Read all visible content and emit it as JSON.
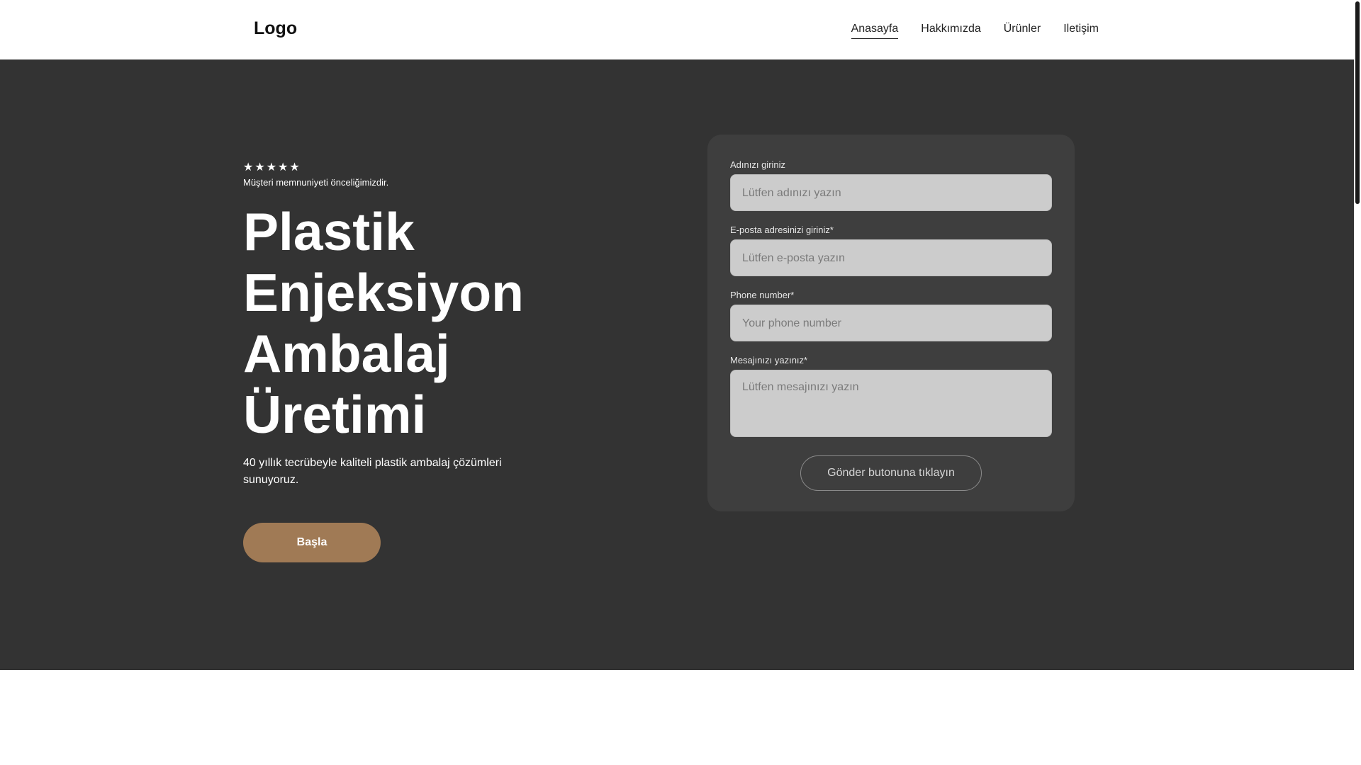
{
  "header": {
    "logo": "Logo",
    "nav": [
      {
        "label": "Anasayfa",
        "active": true
      },
      {
        "label": "Hakkımızda",
        "active": false
      },
      {
        "label": "Ürünler",
        "active": false
      },
      {
        "label": "Iletişim",
        "active": false
      }
    ]
  },
  "hero": {
    "stars": "★★★★★",
    "rating": 5,
    "tagline": "Müşteri memnuniyeti önceliğimizdir.",
    "title_lines": [
      "Plastik",
      "Enjeksiyon",
      "Ambalaj",
      "Üretimi"
    ],
    "subtitle": "40 yıllık tecrübeyle kaliteli plastik ambalaj çözümleri sunuyoruz.",
    "cta_label": "Başla"
  },
  "form": {
    "name": {
      "label": "Adınızı giriniz",
      "placeholder": "Lütfen adınızı yazın",
      "value": ""
    },
    "email": {
      "label": "E-posta adresinizi giriniz*",
      "placeholder": "Lütfen e-posta yazın",
      "value": ""
    },
    "phone": {
      "label": "Phone number*",
      "placeholder": "Your phone number",
      "value": ""
    },
    "message": {
      "label": "Mesajınızı yazınız*",
      "placeholder": "Lütfen mesajınızı yazın",
      "value": ""
    },
    "submit_label": "Gönder butonuna tıklayın"
  },
  "colors": {
    "hero_bg": "#333333",
    "card_bg": "#3e3e3e",
    "input_bg": "#cccccc",
    "cta_bg": "#a07a55",
    "header_bg": "#ffffff"
  },
  "icons": {
    "rating": "star-icon"
  }
}
